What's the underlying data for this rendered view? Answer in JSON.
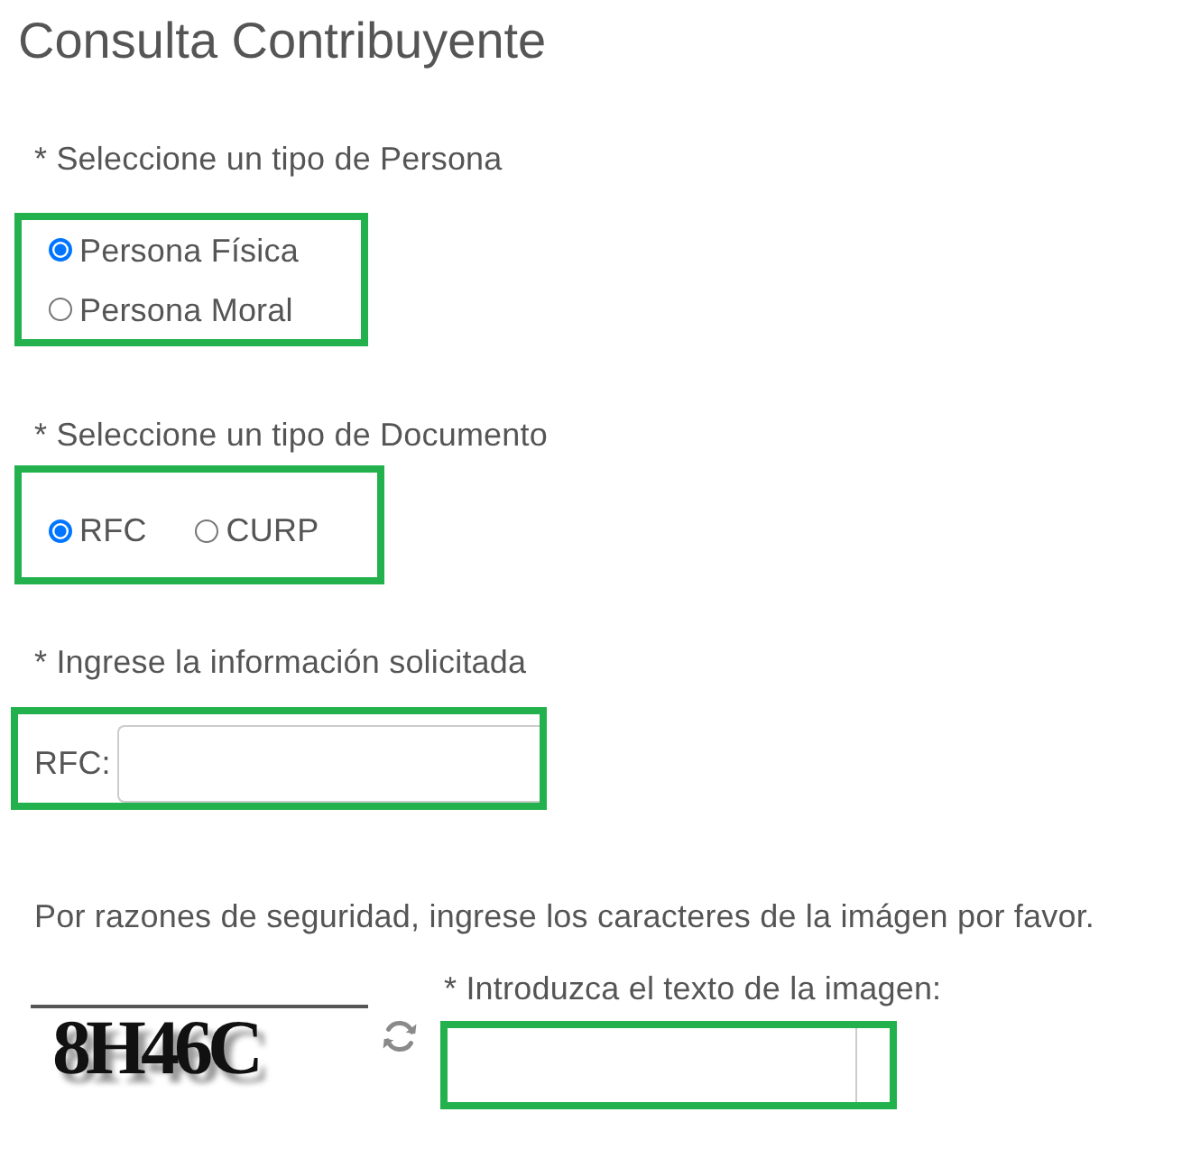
{
  "title": "Consulta Contribuyente",
  "person_type": {
    "label": "* Seleccione un tipo de Persona",
    "highlighted": true,
    "options": [
      {
        "label": "Persona Física",
        "selected": true
      },
      {
        "label": "Persona Moral",
        "selected": false
      }
    ]
  },
  "document_type": {
    "label": "* Seleccione un tipo de Documento",
    "highlighted": true,
    "options": [
      {
        "label": "RFC",
        "selected": true
      },
      {
        "label": "CURP",
        "selected": false
      }
    ]
  },
  "info": {
    "label": "* Ingrese la información solicitada",
    "highlighted": true,
    "field_label": "RFC:"
  },
  "captcha": {
    "instructions": "Por razones de seguridad, ingrese los caracteres de la imágen por favor.",
    "image_text": "8H46C",
    "field_label": "* Introduzca el texto de la imagen:",
    "highlighted": true
  }
}
